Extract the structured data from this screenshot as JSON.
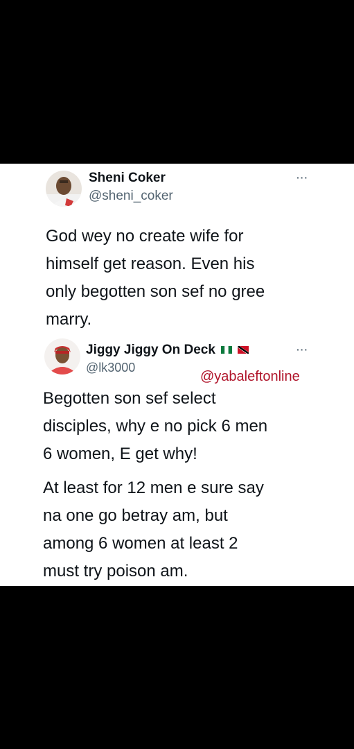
{
  "tweet": {
    "author_name": "Sheni Coker",
    "author_handle": "@sheni_coker",
    "more_icon": "more-horizontal-icon",
    "lines": [
      "God wey no create wife for",
      "himself get reason. Even his",
      "only begotten son sef no gree",
      "marry."
    ]
  },
  "reply": {
    "author_name": "Jiggy Jiggy On Deck",
    "flags": [
      "nigeria-flag-icon",
      "trinidad-flag-icon"
    ],
    "author_handle": "@lk3000",
    "more_icon": "more-horizontal-icon",
    "watermark": "@yabaleftonline",
    "paragraph1": [
      "Begotten son sef select",
      "disciples, why e no pick 6 men",
      "6 women, E get why!"
    ],
    "paragraph2": [
      "At least for 12 men e sure say",
      "na one go betray am, but",
      "among 6 women at least 2",
      "must try poison am."
    ]
  },
  "colors": {
    "background": "#000000",
    "card": "#ffffff",
    "text": "#0f1419",
    "secondary": "#536471",
    "watermark": "#b0142a"
  }
}
